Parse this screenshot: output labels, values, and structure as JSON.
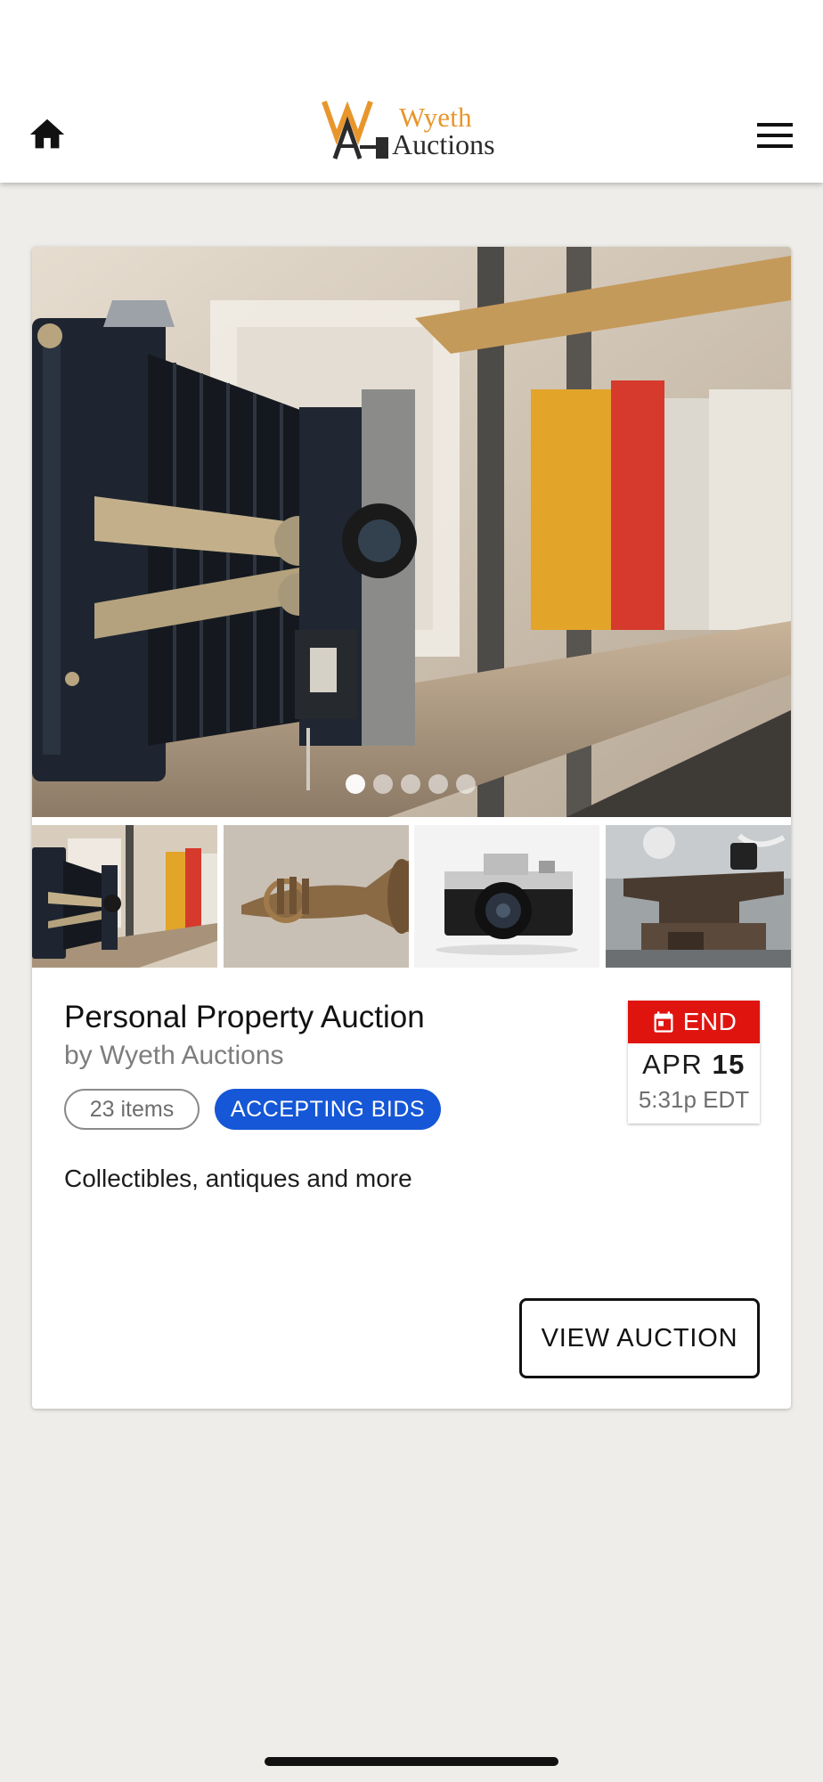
{
  "header": {
    "logo_line1": "Wyeth",
    "logo_line2": "Auctions",
    "logo_mark": "WA",
    "home_icon": "home-icon",
    "menu_icon": "hamburger-menu-icon"
  },
  "auction": {
    "title": "Personal Property Auction",
    "byline": "by Wyeth Auctions",
    "items_count": "23 items",
    "status": "ACCEPTING BIDS",
    "description": "Collectibles, antiques and more",
    "view_button": "VIEW AUCTION",
    "end": {
      "label": "END",
      "month": "APR",
      "day": "15",
      "time": "5:31p EDT",
      "icon": "calendar-icon"
    }
  },
  "gallery": {
    "slide_count": 5,
    "active_slide": 1,
    "thumbnails": [
      {
        "subject": "folding-camera-on-shelf"
      },
      {
        "subject": "brass-horn"
      },
      {
        "subject": "film-camera"
      },
      {
        "subject": "anvil"
      }
    ]
  },
  "colors": {
    "status_blue": "#1557d6",
    "end_red": "#e0140f",
    "logo_orange": "#e8962c",
    "background": "#eeede9"
  }
}
